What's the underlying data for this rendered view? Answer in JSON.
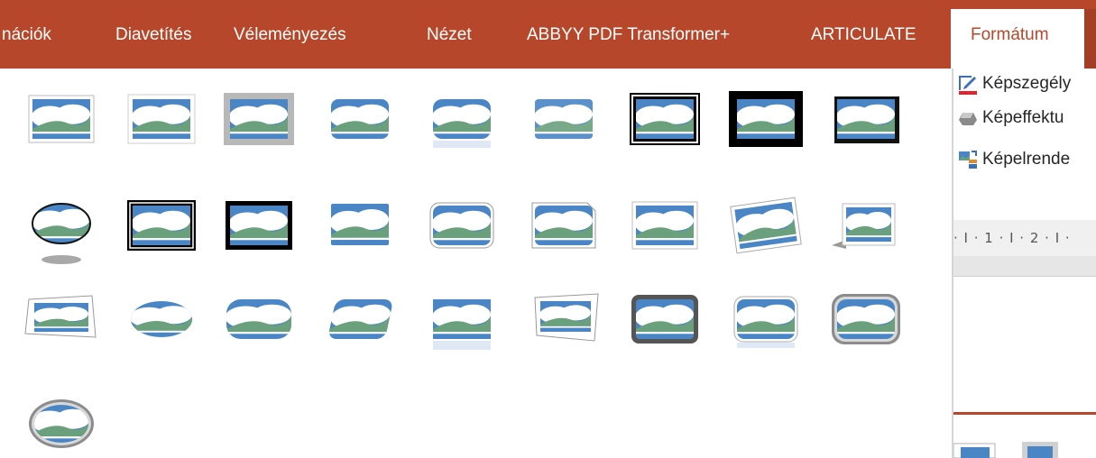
{
  "ribbon": {
    "tabs": [
      {
        "label": "nációk"
      },
      {
        "label": "Diavetítés"
      },
      {
        "label": "Véleményezés"
      },
      {
        "label": "Nézet"
      },
      {
        "label": "ABBYY PDF Transformer+"
      },
      {
        "label": "ARTICULATE"
      }
    ],
    "active_tab": "Formátum"
  },
  "colors": {
    "ribbon_bg": "#b7472a",
    "accent": "#b7472a",
    "sky": "#4a86c5",
    "hill": "#6aa07c"
  },
  "gallery": {
    "style_count": 28,
    "styles": [
      "simple-frame-white",
      "soft-frame-white",
      "thick-matte-gray",
      "rounded-rectangle",
      "reflected-soft-rectangle",
      "soft-edge-rectangle",
      "double-frame-black",
      "thick-matte-black",
      "shadow-rectangle",
      "oval-reflected",
      "double-frame-black-2",
      "black-frame",
      "soft-rectangle-white",
      "rounded-diagonal",
      "snip-corner",
      "simple-white",
      "rotated-white",
      "perspective-shadow",
      "relaxed-perspective",
      "soft-oval",
      "soft-rounded",
      "beveled-perspective",
      "reflected-bevel",
      "perspective-tilted",
      "metal-rounded",
      "reflected-rounded",
      "metal-frame-rounded",
      "metal-oval"
    ]
  },
  "panel": {
    "picture_border": {
      "label": "Képszegély",
      "icon": "picture-border-icon"
    },
    "picture_effects": {
      "label": "Képeffektu",
      "icon": "picture-effects-icon"
    },
    "picture_layout": {
      "label": "Képelrende",
      "icon": "picture-layout-icon"
    },
    "ruler_text": "· I · 1 · I · 2 · I ·"
  }
}
